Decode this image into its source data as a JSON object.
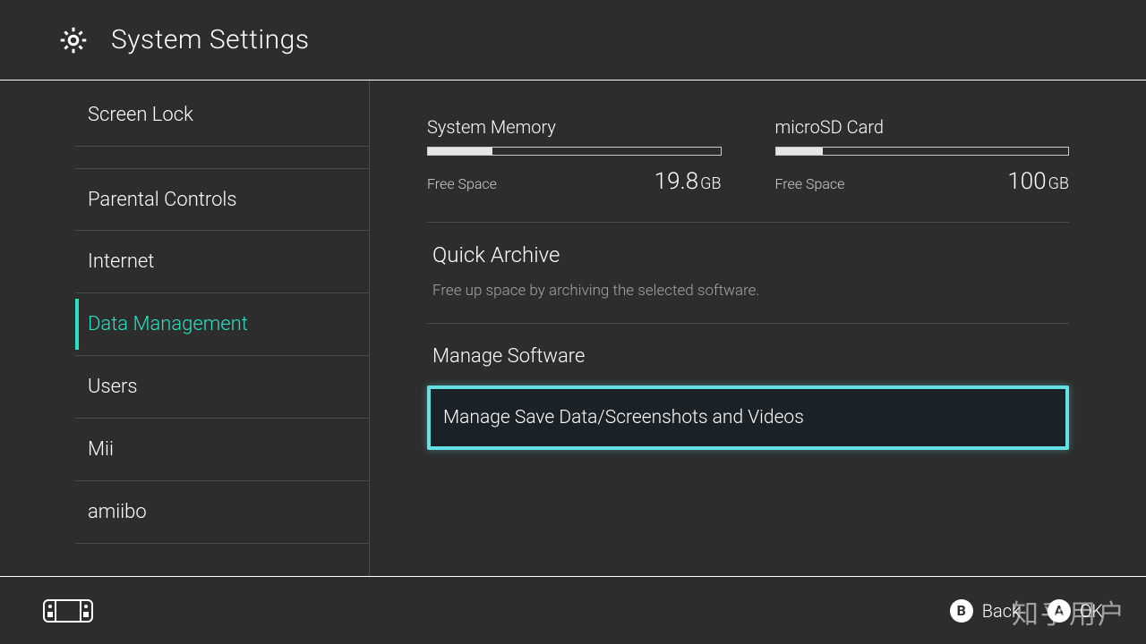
{
  "header": {
    "title": "System Settings"
  },
  "sidebar": {
    "items": [
      {
        "label": "Screen Lock",
        "selected": false
      },
      {
        "label": "Parental Controls",
        "selected": false
      },
      {
        "label": "Internet",
        "selected": false
      },
      {
        "label": "Data Management",
        "selected": true
      },
      {
        "label": "Users",
        "selected": false
      },
      {
        "label": "Mii",
        "selected": false
      },
      {
        "label": "amiibo",
        "selected": false
      }
    ]
  },
  "storage": {
    "system": {
      "title": "System Memory",
      "free_label": "Free Space",
      "free_value": "19.8",
      "unit": "GB",
      "fill_percent": 22
    },
    "sd": {
      "title": "microSD Card",
      "free_label": "Free Space",
      "free_value": "100",
      "unit": "GB",
      "fill_percent": 16
    }
  },
  "quick_archive": {
    "title": "Quick Archive",
    "desc": "Free up space by archiving the selected software."
  },
  "manage": {
    "heading": "Manage Software",
    "option1": "Manage Save Data/Screenshots and Videos"
  },
  "footer": {
    "back_letter": "B",
    "back_label": "Back",
    "ok_letter": "A",
    "ok_label": "OK"
  },
  "watermark": "知乎用户"
}
